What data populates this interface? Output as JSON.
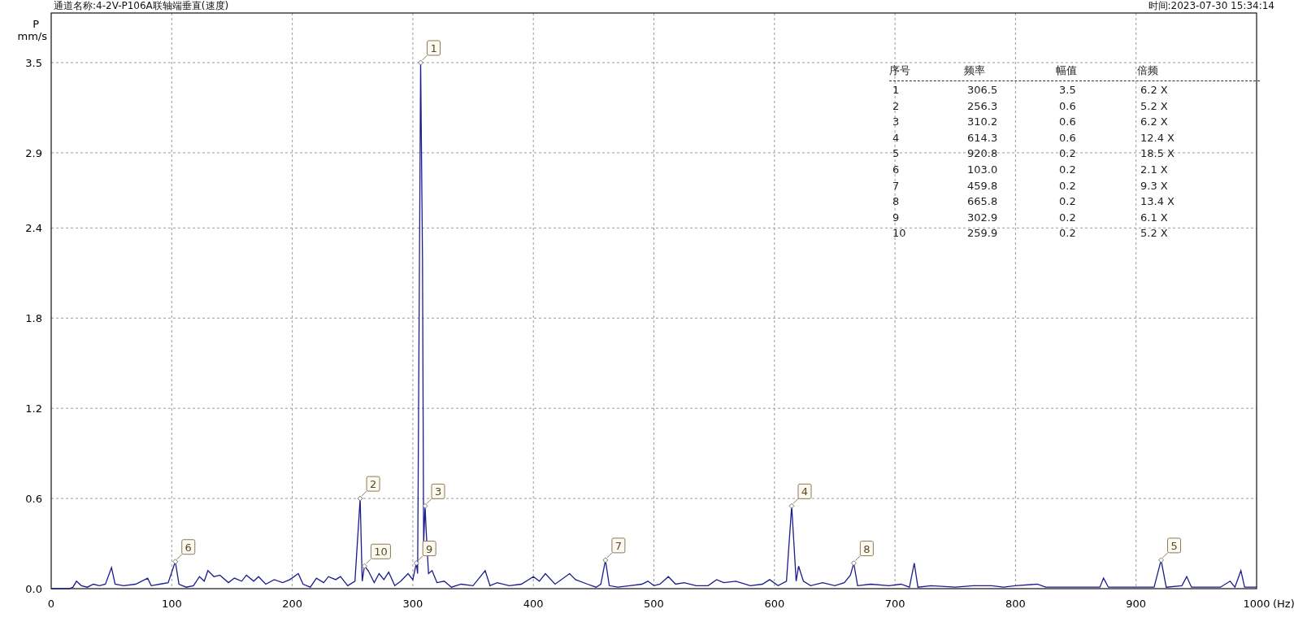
{
  "header": {
    "channel": "通道名称:4-2V-P106A联轴端垂直(速度)",
    "time": "时间:2023-07-30 15:34:14"
  },
  "chart_data": {
    "type": "line",
    "ylabel": "P\nmm/s",
    "xlabel": "(Hz)",
    "xlim": [
      0,
      1000
    ],
    "ylim": [
      0,
      3.83
    ],
    "xticks": [
      0,
      100,
      200,
      300,
      400,
      500,
      600,
      700,
      800,
      900,
      1000
    ],
    "yticks": [
      {
        "value": 0,
        "label": "0.0"
      },
      {
        "value": 0.6,
        "label": "0.6"
      },
      {
        "value": 1.2,
        "label": "1.2"
      },
      {
        "value": 1.8,
        "label": "1.8"
      },
      {
        "value": 2.4,
        "label": "2.4"
      },
      {
        "value": 2.9,
        "label": "2.9"
      },
      {
        "value": 3.5,
        "label": "3.5"
      }
    ],
    "grid": true,
    "x": [
      0,
      15,
      18,
      21,
      25,
      30,
      35,
      40,
      45,
      50,
      53,
      60,
      70,
      80,
      83,
      90,
      97,
      103,
      106,
      112,
      118,
      123,
      127,
      130,
      135,
      140,
      147,
      152,
      158,
      162,
      168,
      172,
      178,
      185,
      192,
      198,
      205,
      209,
      215,
      220,
      226,
      230,
      236,
      240,
      246,
      252,
      256.3,
      258,
      259.9,
      263,
      268,
      272,
      276,
      280,
      285,
      290,
      296,
      300,
      302.9,
      304,
      306.5,
      308,
      309,
      310.2,
      311,
      313,
      316,
      320,
      326,
      332,
      340,
      350,
      360,
      364,
      370,
      380,
      390,
      400,
      405,
      410,
      418,
      430,
      435,
      445,
      452,
      456,
      459.8,
      463,
      470,
      480,
      490,
      495,
      500,
      505,
      512,
      518,
      525,
      535,
      545,
      552,
      558,
      568,
      580,
      590,
      596,
      603,
      610,
      614.3,
      618,
      620,
      624,
      630,
      640,
      650,
      658,
      663,
      665.8,
      669,
      680,
      695,
      705,
      712,
      716,
      719,
      730,
      750,
      765,
      780,
      790,
      800,
      818,
      825,
      850,
      870,
      873,
      877,
      900,
      915,
      920.8,
      925,
      938,
      942,
      946,
      970,
      978,
      982,
      987,
      990,
      1000
    ],
    "series": [
      {
        "color": "#1c1c8c",
        "values": [
          0,
          0,
          0.01,
          0.05,
          0.02,
          0.01,
          0.03,
          0.02,
          0.03,
          0.14,
          0.03,
          0.02,
          0.03,
          0.07,
          0.02,
          0.03,
          0.04,
          0.18,
          0.03,
          0.01,
          0.02,
          0.08,
          0.05,
          0.12,
          0.08,
          0.09,
          0.04,
          0.07,
          0.05,
          0.09,
          0.05,
          0.08,
          0.03,
          0.06,
          0.04,
          0.06,
          0.1,
          0.03,
          0.01,
          0.07,
          0.04,
          0.08,
          0.06,
          0.08,
          0.02,
          0.05,
          0.6,
          0.05,
          0.15,
          0.12,
          0.04,
          0.1,
          0.06,
          0.11,
          0.02,
          0.05,
          0.1,
          0.06,
          0.17,
          0.1,
          3.5,
          2.2,
          0.3,
          0.55,
          0.4,
          0.1,
          0.12,
          0.04,
          0.05,
          0.01,
          0.03,
          0.02,
          0.12,
          0.02,
          0.04,
          0.02,
          0.03,
          0.08,
          0.05,
          0.1,
          0.03,
          0.1,
          0.06,
          0.03,
          0.01,
          0.03,
          0.19,
          0.02,
          0.01,
          0.02,
          0.03,
          0.05,
          0.02,
          0.03,
          0.08,
          0.03,
          0.04,
          0.02,
          0.02,
          0.06,
          0.04,
          0.05,
          0.02,
          0.03,
          0.06,
          0.02,
          0.05,
          0.55,
          0.05,
          0.15,
          0.05,
          0.02,
          0.04,
          0.02,
          0.04,
          0.09,
          0.17,
          0.02,
          0.03,
          0.02,
          0.03,
          0.01,
          0.17,
          0.01,
          0.02,
          0.01,
          0.02,
          0.02,
          0.01,
          0.02,
          0.03,
          0.01,
          0.01,
          0.01,
          0.07,
          0.01,
          0.01,
          0.01,
          0.19,
          0.01,
          0.02,
          0.08,
          0.01,
          0.01,
          0.05,
          0.01,
          0.12,
          0.01,
          0.01
        ]
      }
    ],
    "annotations": [
      {
        "x": 306.5,
        "y": 3.5,
        "text": "1"
      },
      {
        "x": 256.3,
        "y": 0.6,
        "text": "2"
      },
      {
        "x": 310.2,
        "y": 0.55,
        "text": "3"
      },
      {
        "x": 614.3,
        "y": 0.55,
        "text": "4"
      },
      {
        "x": 920.8,
        "y": 0.19,
        "text": "5"
      },
      {
        "x": 103,
        "y": 0.18,
        "text": "6"
      },
      {
        "x": 459.8,
        "y": 0.19,
        "text": "7"
      },
      {
        "x": 665.8,
        "y": 0.17,
        "text": "8"
      },
      {
        "x": 302.9,
        "y": 0.17,
        "text": "9"
      },
      {
        "x": 259.9,
        "y": 0.15,
        "text": "10"
      }
    ]
  },
  "peak_table": {
    "columns": [
      "序号",
      "频率",
      "幅值",
      "倍频"
    ],
    "rows": [
      [
        "1",
        "306.5",
        "3.5",
        "6.2 X"
      ],
      [
        "2",
        "256.3",
        "0.6",
        "5.2 X"
      ],
      [
        "3",
        "310.2",
        "0.6",
        "6.2 X"
      ],
      [
        "4",
        "614.3",
        "0.6",
        "12.4 X"
      ],
      [
        "5",
        "920.8",
        "0.2",
        "18.5 X"
      ],
      [
        "6",
        "103.0",
        "0.2",
        "2.1 X"
      ],
      [
        "7",
        "459.8",
        "0.2",
        "9.3 X"
      ],
      [
        "8",
        "665.8",
        "0.2",
        "13.4 X"
      ],
      [
        "9",
        "302.9",
        "0.2",
        "6.1 X"
      ],
      [
        "10",
        "259.9",
        "0.2",
        "5.2 X"
      ]
    ]
  }
}
